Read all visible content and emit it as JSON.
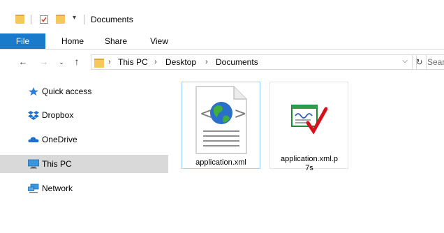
{
  "window": {
    "title": "Documents"
  },
  "ribbon": {
    "tabs": [
      {
        "label": "File"
      },
      {
        "label": "Home"
      },
      {
        "label": "Share"
      },
      {
        "label": "View"
      }
    ]
  },
  "address": {
    "breadcrumbs": [
      {
        "label": "This PC"
      },
      {
        "label": "Desktop"
      },
      {
        "label": "Documents"
      }
    ],
    "separator": "›"
  },
  "search": {
    "placeholder": "Search Documents"
  },
  "sidebar": {
    "items": [
      {
        "label": "Quick access",
        "icon": "star-icon"
      },
      {
        "label": "Dropbox",
        "icon": "dropbox-icon"
      },
      {
        "label": "OneDrive",
        "icon": "cloud-icon"
      },
      {
        "label": "This PC",
        "icon": "computer-icon",
        "selected": true
      },
      {
        "label": "Network",
        "icon": "network-icon"
      }
    ]
  },
  "files": [
    {
      "name": "application.xml",
      "icon": "xml-web-file-icon",
      "selected": true
    },
    {
      "name": "application.xml.p7s",
      "icon": "signed-certificate-icon",
      "selected": false
    }
  ],
  "colors": {
    "accent": "#1979ca",
    "selection_border": "#99d1ff",
    "sidebar_selected": "#d9d9d9",
    "folder": "#f5c85a"
  }
}
